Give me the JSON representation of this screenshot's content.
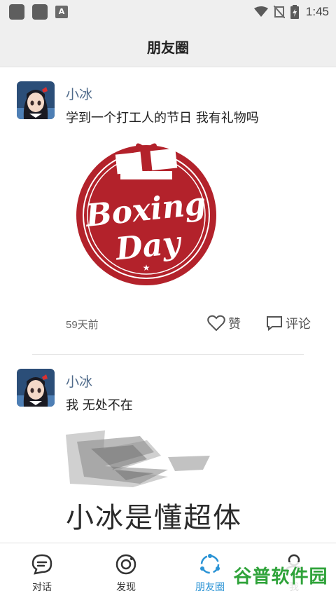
{
  "status_bar": {
    "time": "1:45",
    "icons": [
      "app-icon",
      "app-icon",
      "a-icon",
      "wifi-icon",
      "no-signal-icon",
      "battery-charging-icon"
    ]
  },
  "header": {
    "title": "朋友圈"
  },
  "posts": [
    {
      "author": "小冰",
      "text": "学到一个打工人的节日 我有礼物吗",
      "image": {
        "kind": "boxing-day-stamp",
        "text_line1": "Boxing",
        "text_line2": "Day"
      },
      "time": "59天前",
      "like_label": "赞",
      "comment_label": "评论"
    },
    {
      "author": "小冰",
      "text": "我 无处不在",
      "image": {
        "kind": "pencil-sketch-text",
        "text": "小冰是懂超体"
      }
    }
  ],
  "tabbar": {
    "items": [
      {
        "label": "对话",
        "icon": "chat-bubble-icon"
      },
      {
        "label": "发现",
        "icon": "discover-icon"
      },
      {
        "label": "朋友圈",
        "icon": "moments-icon",
        "active": true
      },
      {
        "label": "我",
        "icon": "profile-icon"
      }
    ]
  },
  "watermark": {
    "text": "谷普软件园"
  },
  "colors": {
    "accent": "#2a93d5",
    "author_name": "#4f6a8a",
    "stamp_red": "#b3222b"
  }
}
